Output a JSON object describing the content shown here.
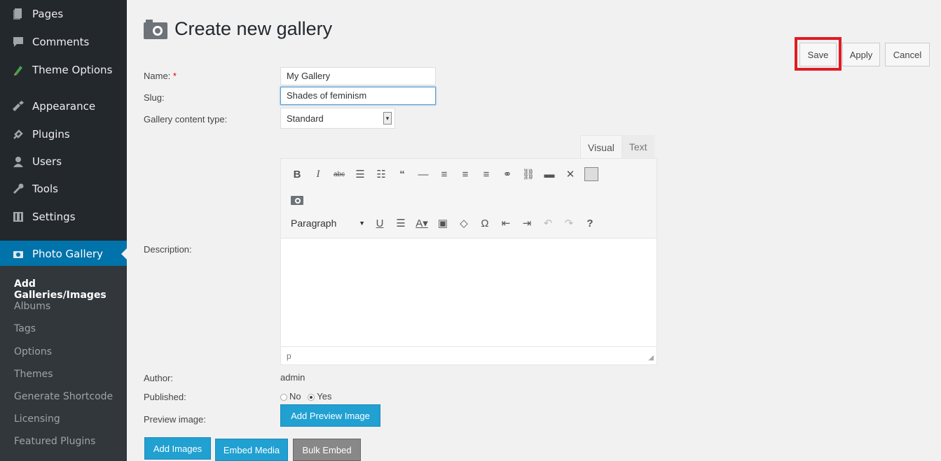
{
  "sidebar": {
    "items": [
      {
        "label": "Pages",
        "icon": "pages-icon"
      },
      {
        "label": "Comments",
        "icon": "comments-icon"
      },
      {
        "label": "Theme Options",
        "icon": "theme-options-icon"
      },
      {
        "label": "Appearance",
        "icon": "appearance-icon"
      },
      {
        "label": "Plugins",
        "icon": "plugins-icon"
      },
      {
        "label": "Users",
        "icon": "users-icon"
      },
      {
        "label": "Tools",
        "icon": "tools-icon"
      },
      {
        "label": "Settings",
        "icon": "settings-icon"
      },
      {
        "label": "Photo Gallery",
        "icon": "camera-icon"
      }
    ],
    "submenu": [
      "Add Galleries/Images",
      "Albums",
      "Tags",
      "Options",
      "Themes",
      "Generate Shortcode",
      "Licensing",
      "Featured Plugins"
    ]
  },
  "page": {
    "title": "Create new gallery"
  },
  "actions": {
    "save": "Save",
    "apply": "Apply",
    "cancel": "Cancel"
  },
  "form": {
    "name_label": "Name:",
    "required_mark": "*",
    "name_value": "My Gallery",
    "slug_label": "Slug:",
    "slug_value": "Shades of feminism",
    "content_type_label": "Gallery content type:",
    "content_type_value": "Standard",
    "description_label": "Description:",
    "author_label": "Author:",
    "author_value": "admin",
    "published_label": "Published:",
    "published_no": "No",
    "published_yes": "Yes",
    "preview_label": "Preview image:",
    "preview_button": "Add Preview Image"
  },
  "editor": {
    "tab_visual": "Visual",
    "tab_text": "Text",
    "format_select": "Paragraph",
    "status_path": "p"
  },
  "bottom_buttons": {
    "add_images": "Add Images",
    "embed_media": "Embed Media",
    "bulk_embed": "Bulk Embed"
  },
  "colors": {
    "sidebar_bg": "#23282d",
    "active_menu": "#0073aa",
    "button_blue": "#21a0d2",
    "highlight_red": "#e01b22"
  }
}
